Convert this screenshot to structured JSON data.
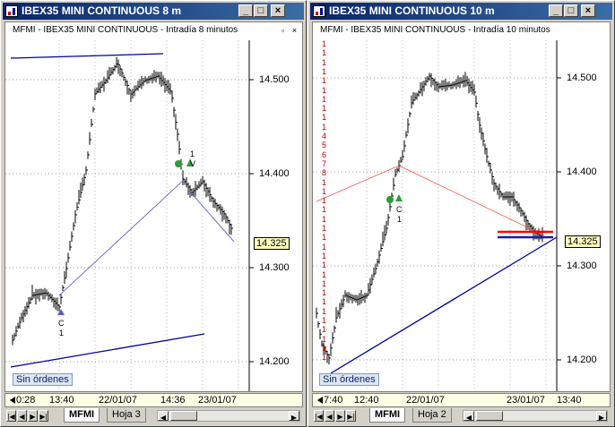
{
  "left": {
    "window_title": "IBEX35 MINI CONTINUOUS 8 m",
    "chart_title": "MFMI - IBEX35 MINI CONTINUOUS - Intradía 8 minutos",
    "price_labels": [
      "14.500",
      "14.400",
      "14.300",
      "14.200"
    ],
    "last_price": "14.325",
    "orders_label": "Sin órdenes",
    "time_labels": [
      "0:28",
      "13:40",
      "22/01/07",
      "14:36",
      "23/01/07"
    ],
    "tabs": [
      "MFMI",
      "Hoja 3"
    ],
    "signals": [
      {
        "letter": "C",
        "count": "1"
      },
      {
        "letter": "V",
        "count": "1"
      }
    ]
  },
  "right": {
    "window_title": "IBEX35 MINI CONTINUOUS 10 m",
    "chart_title": "MFMI - IBEX35 MINI CONTINUOUS - Intradía 10 minutos",
    "price_labels": [
      "14.500",
      "14.400",
      "14.300",
      "14.200"
    ],
    "last_price": "14.325",
    "orders_label": "Sin órdenes",
    "time_labels": [
      "7:40",
      "12:40",
      "22/01/07",
      "23/01/07",
      "13:40"
    ],
    "tabs": [
      "MFMI",
      "Hoja 2"
    ],
    "signals": [
      {
        "letter": "C",
        "count": "1"
      }
    ],
    "volume_marks": [
      "1",
      "1",
      "1",
      "1",
      "1",
      "1",
      "1",
      "1",
      "1",
      "1",
      "4",
      "5",
      "6",
      "7",
      "8",
      "1",
      "1",
      "1",
      "1",
      "1",
      "1",
      "1",
      "1",
      "1",
      "1",
      "1",
      "1",
      "1",
      "1",
      "1",
      "1",
      "1",
      "1",
      "1",
      "1"
    ]
  },
  "window_buttons": {
    "minimize": "_",
    "maximize": "□",
    "close": "×"
  },
  "colors": {
    "titlebar": "#0a246a",
    "price_bars": "#000000",
    "trend_blue": "#000099",
    "trend_red": "#ff0000"
  }
}
